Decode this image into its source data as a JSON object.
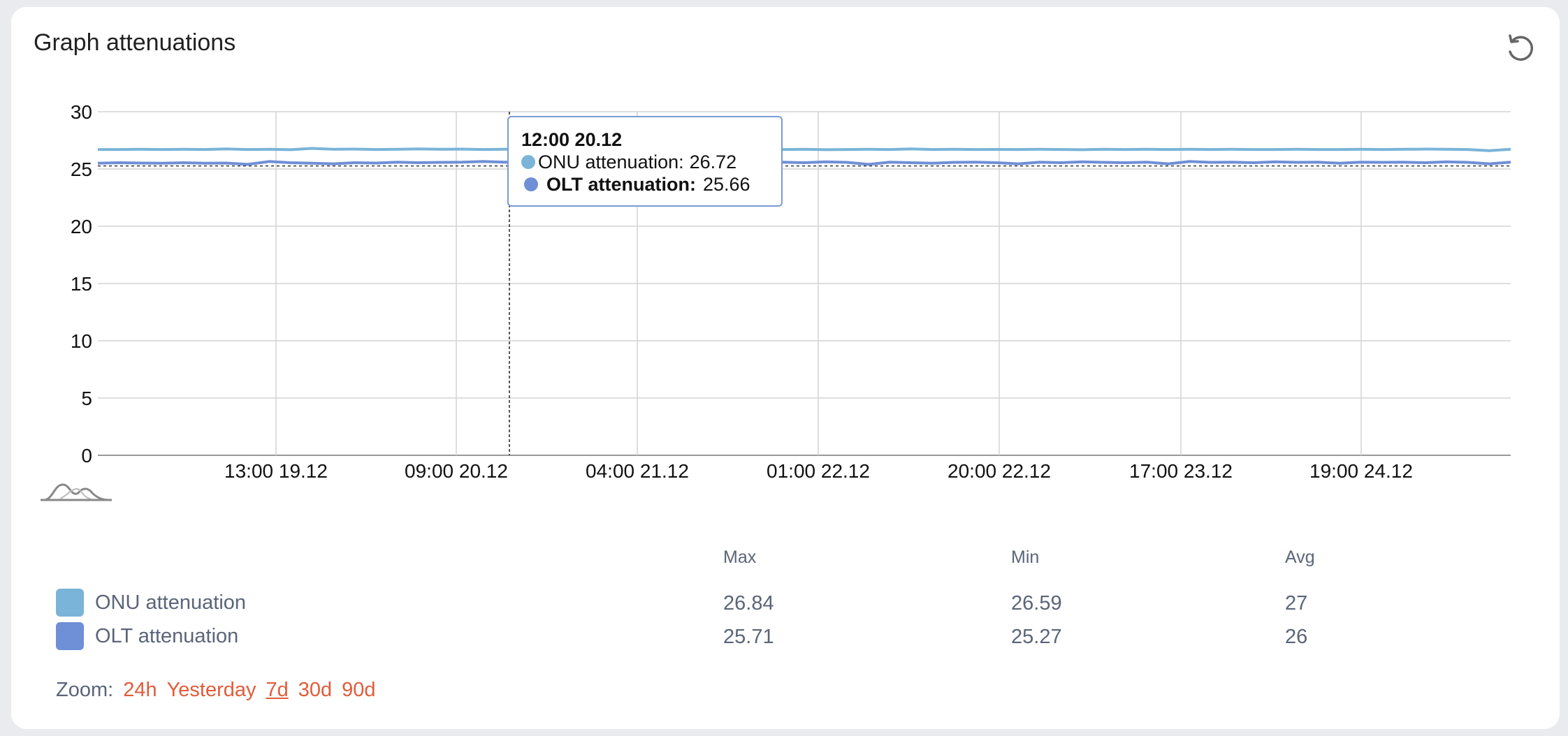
{
  "title": "Graph attenuations",
  "refresh_icon": "refresh-icon",
  "navigator_icon": "navigator-icon",
  "colors": {
    "onu": "#7ab4d8",
    "olt": "#6f8fd6",
    "zoom_accent": "#e15c3a"
  },
  "tooltip": {
    "title": "12:00 20.12",
    "onu_label": "ONU attenuation:",
    "onu_value": "26.72",
    "olt_label": "OLT attenuation:",
    "olt_value": "25.66"
  },
  "chart_data": {
    "type": "line",
    "ylim": [
      0,
      30
    ],
    "yticks": [
      "0",
      "5",
      "10",
      "15",
      "20",
      "25",
      "30"
    ],
    "xticks": [
      "13:00 19.12",
      "09:00 20.12",
      "04:00 21.12",
      "01:00 22.12",
      "20:00 22.12",
      "17:00 23.12",
      "19:00 24.12"
    ],
    "grid": true,
    "reference_line": 25.27,
    "crosshair_x": "12:00 20.12",
    "series": [
      {
        "name": "ONU attenuation",
        "values": [
          26.7,
          26.7,
          26.72,
          26.7,
          26.72,
          26.7,
          26.75,
          26.7,
          26.72,
          26.68,
          26.8,
          26.72,
          26.74,
          26.7,
          26.72,
          26.75,
          26.72,
          26.74,
          26.7,
          26.72,
          26.7,
          26.68,
          26.72,
          26.7,
          26.74,
          26.72,
          26.7,
          26.72,
          26.7,
          26.71,
          26.7,
          26.72,
          26.7,
          26.72,
          26.68,
          26.7,
          26.72,
          26.7,
          26.75,
          26.7,
          26.72,
          26.7,
          26.71,
          26.7,
          26.72,
          26.7,
          26.68,
          26.72,
          26.7,
          26.72,
          26.7,
          26.72,
          26.7,
          26.72,
          26.7,
          26.7,
          26.72,
          26.7,
          26.7,
          26.72,
          26.7,
          26.72,
          26.74,
          26.72,
          26.7,
          26.6,
          26.72
        ]
      },
      {
        "name": "OLT attenuation",
        "values": [
          25.5,
          25.55,
          25.52,
          25.5,
          25.55,
          25.5,
          25.52,
          25.4,
          25.65,
          25.55,
          25.5,
          25.45,
          25.55,
          25.52,
          25.6,
          25.55,
          25.58,
          25.6,
          25.66,
          25.6,
          25.62,
          25.58,
          25.6,
          25.55,
          25.6,
          25.62,
          25.58,
          25.6,
          25.62,
          25.55,
          25.5,
          25.58,
          25.6,
          25.55,
          25.62,
          25.58,
          25.4,
          25.6,
          25.55,
          25.5,
          25.58,
          25.6,
          25.55,
          25.45,
          25.6,
          25.55,
          25.62,
          25.58,
          25.55,
          25.6,
          25.45,
          25.65,
          25.58,
          25.6,
          25.55,
          25.62,
          25.58,
          25.6,
          25.5,
          25.6,
          25.58,
          25.6,
          25.55,
          25.62,
          25.58,
          25.45,
          25.6
        ]
      }
    ]
  },
  "legend": {
    "headers": {
      "max": "Max",
      "min": "Min",
      "avg": "Avg"
    },
    "rows": [
      {
        "name": "ONU attenuation",
        "max": "26.84",
        "min": "26.59",
        "avg": "27"
      },
      {
        "name": "OLT attenuation",
        "max": "25.71",
        "min": "25.27",
        "avg": "26"
      }
    ]
  },
  "zoom": {
    "label": "Zoom:",
    "options": [
      "24h",
      "Yesterday",
      "7d",
      "30d",
      "90d"
    ],
    "active": "7d"
  }
}
